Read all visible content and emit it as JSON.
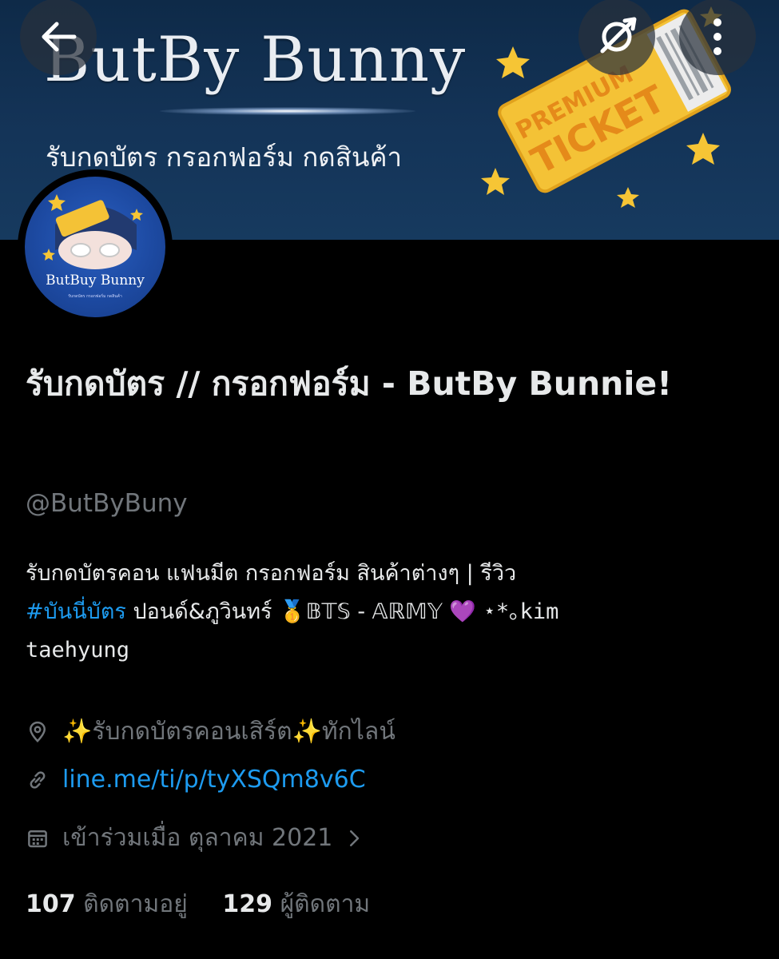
{
  "banner": {
    "title": "ButBy Bunny",
    "subtitle": "รับกดบัตร กรอกฟอร์ม กดสินค้า",
    "ticket_text_1": "PREMIUM",
    "ticket_text_2": "TICKET"
  },
  "avatar": {
    "name": "ButBuy Bunny",
    "ticket_label": "PREMIUM TICKET",
    "small_text": "รับกดบัตร กรอกฟอร์ม กดสินค้า"
  },
  "profile": {
    "display_name": "รับกดบัตร // กรอกฟอร์ม - ButBy Bunnie!",
    "handle": "@ButByBuny",
    "bio_line1": "รับกดบัตรคอน แฟนมีต กรอกฟอร์ม  สินค้าต่างๆ | รีวิว",
    "bio_hashtag": "#บันนี่บัตร",
    "bio_line2_rest": " ปอนด์&ภูวินทร์ 🥇𝔹𝕋𝕊 - 𝔸ℝ𝕄𝕐 💜 ",
    "bio_mono_1": "⋆*｡kim",
    "bio_mono_2": "taehyung",
    "location": "✨รับกดบัตรคอนเสิร์ต✨ทักไลน์",
    "link": "line.me/ti/p/tyXSQm8v6C",
    "joined": "เข้าร่วมเมื่อ ตุลาคม 2021",
    "following_count": "107",
    "following_label": "ติดตามอยู่",
    "followers_count": "129",
    "followers_label": "ผู้ติดตาม"
  },
  "colors": {
    "background": "#000000",
    "text": "#e7e9ea",
    "muted": "#71767b",
    "accent": "#1d9bf0",
    "banner": "#143458"
  },
  "icons": [
    "back-arrow-icon",
    "tag-off-icon",
    "more-vertical-icon",
    "location-pin-icon",
    "link-icon",
    "calendar-icon",
    "chevron-right-icon"
  ]
}
